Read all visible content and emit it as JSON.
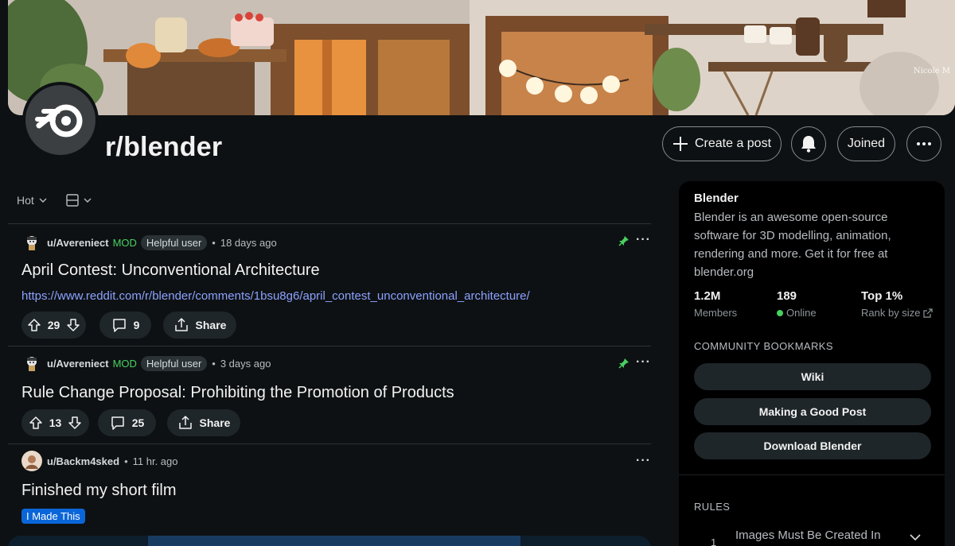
{
  "banner": {
    "credit": "Nicole M"
  },
  "header": {
    "subreddit": "r/blender",
    "create_post": "Create a post",
    "joined": "Joined"
  },
  "feed": {
    "sort": "Hot",
    "posts": [
      {
        "author": "u/Avereniect",
        "mod": "MOD",
        "flair": "Helpful user",
        "time": "18 days ago",
        "pinned": true,
        "title": "April Contest: Unconventional Architecture",
        "link": "https://www.reddit.com/r/blender/comments/1bsu8g6/april_contest_unconventional_architecture/",
        "votes": "29",
        "comments": "9",
        "share": "Share"
      },
      {
        "author": "u/Avereniect",
        "mod": "MOD",
        "flair": "Helpful user",
        "time": "3 days ago",
        "pinned": true,
        "title": "Rule Change Proposal: Prohibiting the Promotion of Products",
        "votes": "13",
        "comments": "25",
        "share": "Share"
      },
      {
        "author": "u/Backm4sked",
        "time": "11 hr. ago",
        "pinned": false,
        "title": "Finished my short film",
        "tag": "I Made This"
      }
    ]
  },
  "sidebar": {
    "title": "Blender",
    "description": "Blender is an awesome open-source software for 3D modelling, animation, rendering and more. Get it for free at blender.org",
    "stats": [
      {
        "value": "1.2M",
        "label": "Members"
      },
      {
        "value": "189",
        "label": "Online"
      },
      {
        "value": "Top 1%",
        "label": "Rank by size"
      }
    ],
    "bookmarks_heading": "COMMUNITY BOOKMARKS",
    "bookmarks": [
      "Wiki",
      "Making a Good Post",
      "Download Blender"
    ],
    "rules_heading": "RULES",
    "rules": [
      {
        "number": "1",
        "text": "Images Must Be Created In"
      }
    ]
  },
  "colors": {
    "background": "#0e1113",
    "link": "#8ba2ff",
    "mod": "#46d160",
    "tag": "#0a66d8"
  }
}
